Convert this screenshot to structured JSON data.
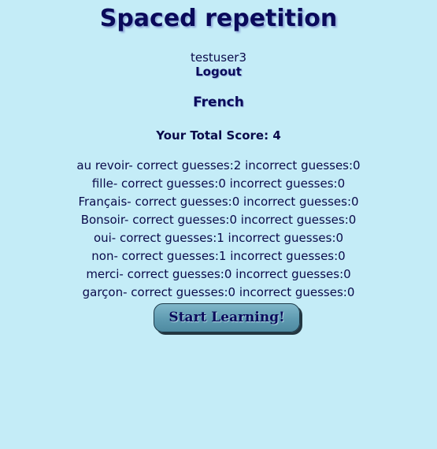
{
  "app": {
    "title": "Spaced repetition"
  },
  "user": {
    "username": "testuser3",
    "logout_label": "Logout"
  },
  "language": "French",
  "score_text": "Your Total Score: 4",
  "words": [
    "au revoir- correct guesses:2 incorrect guesses:0",
    "fille- correct guesses:0 incorrect guesses:0",
    "Français- correct guesses:0 incorrect guesses:0",
    "Bonsoir- correct guesses:0 incorrect guesses:0",
    "oui- correct guesses:1 incorrect guesses:0",
    "non- correct guesses:1 incorrect guesses:0",
    "merci- correct guesses:0 incorrect guesses:0",
    "garçon- correct guesses:0 incorrect guesses:0"
  ],
  "start_button_label": "Start Learning!"
}
